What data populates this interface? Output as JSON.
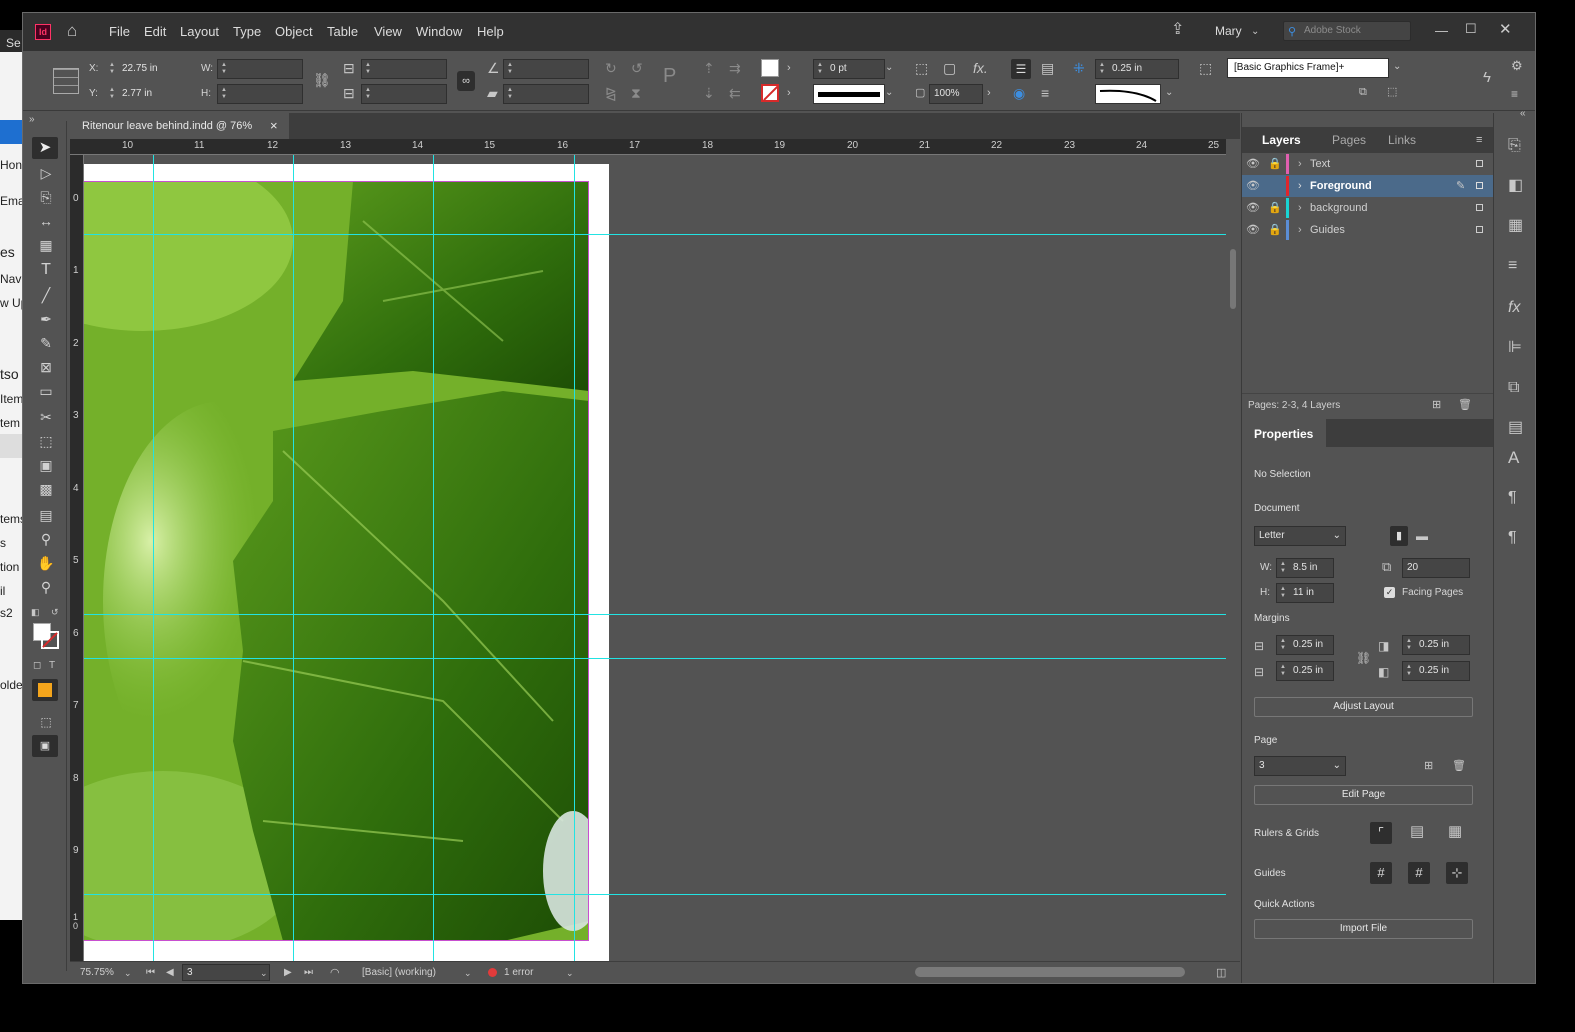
{
  "background_window": {
    "fragments": [
      "Se",
      "Hon",
      "Ema",
      "es",
      "Navi",
      "w Up",
      "tso",
      "Item",
      "tem",
      "tems",
      "s",
      "tion",
      "il",
      "s2",
      "olde"
    ]
  },
  "menubar": {
    "app_badge": "Id",
    "items": [
      "File",
      "Edit",
      "Layout",
      "Type",
      "Object",
      "Table",
      "View",
      "Window",
      "Help"
    ],
    "user": "Mary",
    "stock_placeholder": "Adobe Stock"
  },
  "control": {
    "x_label": "X:",
    "x_value": "22.75 in",
    "y_label": "Y:",
    "y_value": "2.77 in",
    "w_label": "W:",
    "h_label": "H:",
    "stroke_weight": "0 pt",
    "opacity": "100%",
    "gap_value": "0.25 in",
    "object_style": "[Basic Graphics Frame]+"
  },
  "document_tab": {
    "title": "Ritenour leave behind.indd @ 76%",
    "close": "×"
  },
  "ruler": {
    "h_ticks": [
      "10",
      "11",
      "12",
      "13",
      "14",
      "15",
      "16",
      "17",
      "18",
      "19",
      "20",
      "21",
      "22",
      "23",
      "24",
      "25"
    ],
    "v_ticks": [
      "0",
      "1",
      "2",
      "3",
      "4",
      "5",
      "6",
      "7",
      "8",
      "9",
      "1 0"
    ]
  },
  "status": {
    "zoom": "75.75%",
    "page": "3",
    "preflight_profile": "[Basic] (working)",
    "errors": "1 error"
  },
  "panel": {
    "tabs": [
      "Layers",
      "Pages",
      "Links"
    ],
    "layers": [
      {
        "name": "Text",
        "color": "#e05fb0",
        "locked": true,
        "selected": false
      },
      {
        "name": "Foreground",
        "color": "#e0262b",
        "locked": false,
        "selected": true
      },
      {
        "name": "background",
        "color": "#19d4d4",
        "locked": true,
        "selected": false
      },
      {
        "name": "Guides",
        "color": "#5b8ed6",
        "locked": true,
        "selected": false
      }
    ],
    "layers_footer": "Pages: 2-3, 4 Layers",
    "properties_title": "Properties",
    "no_selection": "No Selection",
    "document_label": "Document",
    "page_size": "Letter",
    "w_label": "W:",
    "w_value": "8.5 in",
    "h_label": "H:",
    "h_value": "11 in",
    "pages_count": "20",
    "facing_pages": "Facing Pages",
    "margins_label": "Margins",
    "margin_top": "0.25 in",
    "margin_bottom": "0.25 in",
    "margin_left": "0.25 in",
    "margin_right": "0.25 in",
    "adjust_layout": "Adjust Layout",
    "page_label": "Page",
    "page_value": "3",
    "edit_page": "Edit Page",
    "rulers_grids": "Rulers & Grids",
    "guides": "Guides",
    "quick_actions": "Quick Actions",
    "import_file": "Import File"
  },
  "colors": {
    "guide": "#22e3e3",
    "selected_layer": "#4b6a8a",
    "accent_orange": "#f4a51c",
    "error_red": "#e23b3b"
  }
}
